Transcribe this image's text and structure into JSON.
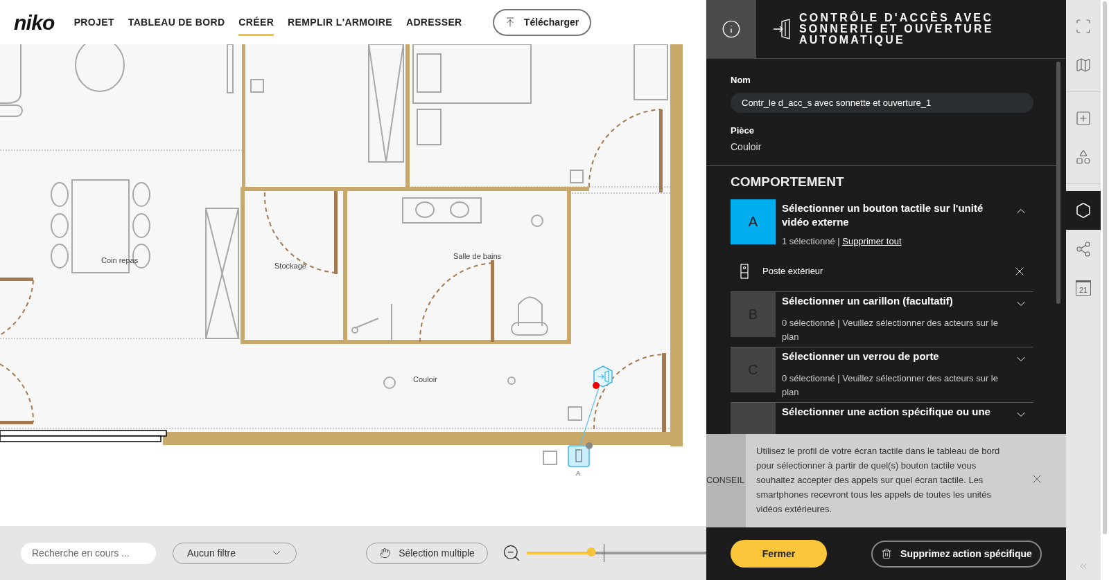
{
  "header": {
    "logo": "niko",
    "nav": [
      {
        "label": "PROJET",
        "selected": false
      },
      {
        "label": "TABLEAU DE BORD",
        "selected": false
      },
      {
        "label": "CRÉER",
        "selected": true
      },
      {
        "label": "REMPLIR L'ARMOIRE",
        "selected": false
      },
      {
        "label": "ADRESSER",
        "selected": false
      }
    ],
    "upload_button": "Télécharger"
  },
  "plan": {
    "rooms": [
      {
        "label": "Coin repas",
        "kind": "dining"
      },
      {
        "label": "Stockage",
        "kind": "storage"
      },
      {
        "label": "Salle de bains",
        "kind": "bathroom"
      },
      {
        "label": "Couloir",
        "kind": "hallway"
      }
    ],
    "device_label": "A"
  },
  "bottom_bar": {
    "search": {
      "placeholder": "Recherche en cours ..."
    },
    "filter": "Aucun filtre",
    "multi_select": "Sélection multiple",
    "zoom": {
      "level": 0.36
    }
  },
  "panel": {
    "title": "CONTRÔLE D'ACCÈS AVEC SONNERIE ET OUVERTURE AUTOMATIQUE",
    "name_label": "Nom",
    "name_value": "Contr_le d_acc_s avec sonnette et ouverture_1",
    "room_label": "Pièce",
    "room_value": "Couloir",
    "section": "COMPORTEMENT",
    "steps": [
      {
        "letter": "A",
        "title": "Sélectionner un bouton tactile sur l'unité vidéo externe",
        "selected": true,
        "expanded": true,
        "status": "1 sélectionné |",
        "link": "Supprimer tout",
        "items": [
          "Poste extérieur"
        ]
      },
      {
        "letter": "B",
        "title": "Sélectionner un carillon (facultatif)",
        "selected": false,
        "expanded": false,
        "status": "0 sélectionné | Veuillez sélectionner des acteurs sur le plan"
      },
      {
        "letter": "C",
        "title": "Sélectionner un verrou de porte",
        "selected": false,
        "expanded": false,
        "status": "0 sélectionné | Veuillez sélectionner des acteurs sur le plan"
      },
      {
        "title": "Sélectionner une action spécifique ou une",
        "selected": false,
        "expanded": false
      }
    ],
    "tip": {
      "label": "CONSEIL",
      "text": "Utilisez le profil de votre écran tactile dans le tableau de bord pour sélectionner à partir de quel(s) bouton tactile vous souhaitez accepter des appels sur quel écran tactile. Les smartphones recevront tous les appels de toutes les unités vidéos extérieures."
    },
    "close_button": "Fermer",
    "delete_button": "Supprimez action spécifique"
  },
  "toolbar": {
    "groups": [
      [
        {
          "kind": "fullscreen",
          "selected": false
        },
        {
          "kind": "map",
          "selected": false
        }
      ],
      [
        {
          "kind": "add",
          "selected": false
        },
        {
          "kind": "add-shape",
          "selected": false
        }
      ],
      [
        {
          "kind": "hex-add",
          "selected": true
        },
        {
          "kind": "network",
          "selected": false
        },
        {
          "kind": "calendar",
          "selected": false,
          "text": "21"
        }
      ]
    ]
  }
}
